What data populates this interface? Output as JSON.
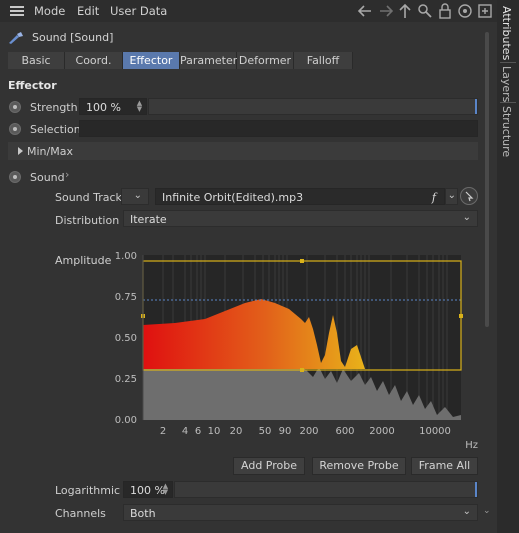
{
  "menubar": {
    "items": [
      "Mode",
      "Edit",
      "User Data"
    ],
    "icons": [
      "arrow-left-icon",
      "arrow-right-icon",
      "arrow-up-icon",
      "search-icon",
      "lock-icon",
      "target-icon",
      "new-panel-icon"
    ]
  },
  "object": {
    "title": "Sound [Sound]"
  },
  "tabs": [
    {
      "label": "Basic",
      "active": false
    },
    {
      "label": "Coord.",
      "active": false
    },
    {
      "label": "Effector",
      "active": true
    },
    {
      "label": "Parameter",
      "active": false
    },
    {
      "label": "Deformer",
      "active": false
    },
    {
      "label": "Falloff",
      "active": false
    }
  ],
  "effector": {
    "section_title": "Effector",
    "strength_label": "Strength",
    "strength_value": "100 %",
    "strength_level": 1.0,
    "selection_label": "Selection",
    "selection_value": "",
    "minmax_label": "Min/Max"
  },
  "sound": {
    "label": "Sound",
    "track_label": "Sound Track",
    "track_value": "Infinite Orbit(Edited).mp3",
    "track_f": "f",
    "distribution_label": "Distribution",
    "distribution_value": "Iterate",
    "amplitude_label": "Amplitude",
    "y_ticks": [
      "1.00",
      "0.75",
      "0.50",
      "0.25",
      "0.00"
    ],
    "x_ticks": [
      "2",
      "4",
      "6",
      "10",
      "20",
      "50",
      "90",
      "200",
      "600",
      "2000",
      "10000"
    ],
    "x_unit": "Hz",
    "buttons": {
      "add_probe": "Add Probe",
      "remove_probe": "Remove Probe",
      "frame_all": "Frame All"
    },
    "logarithmic_label": "Logarithmic",
    "logarithmic_value": "100 %",
    "logarithmic_level": 1.0,
    "channels_label": "Channels",
    "channels_value": "Both"
  },
  "sidetabs": [
    "Attributes",
    "Layers",
    "Structure"
  ],
  "colors": {
    "accent": "#5a79ad",
    "probe": "#d9b21a",
    "spectrum_low": "#e01010",
    "spectrum_high": "#e8b21a",
    "threshold": "#5a85c8"
  }
}
